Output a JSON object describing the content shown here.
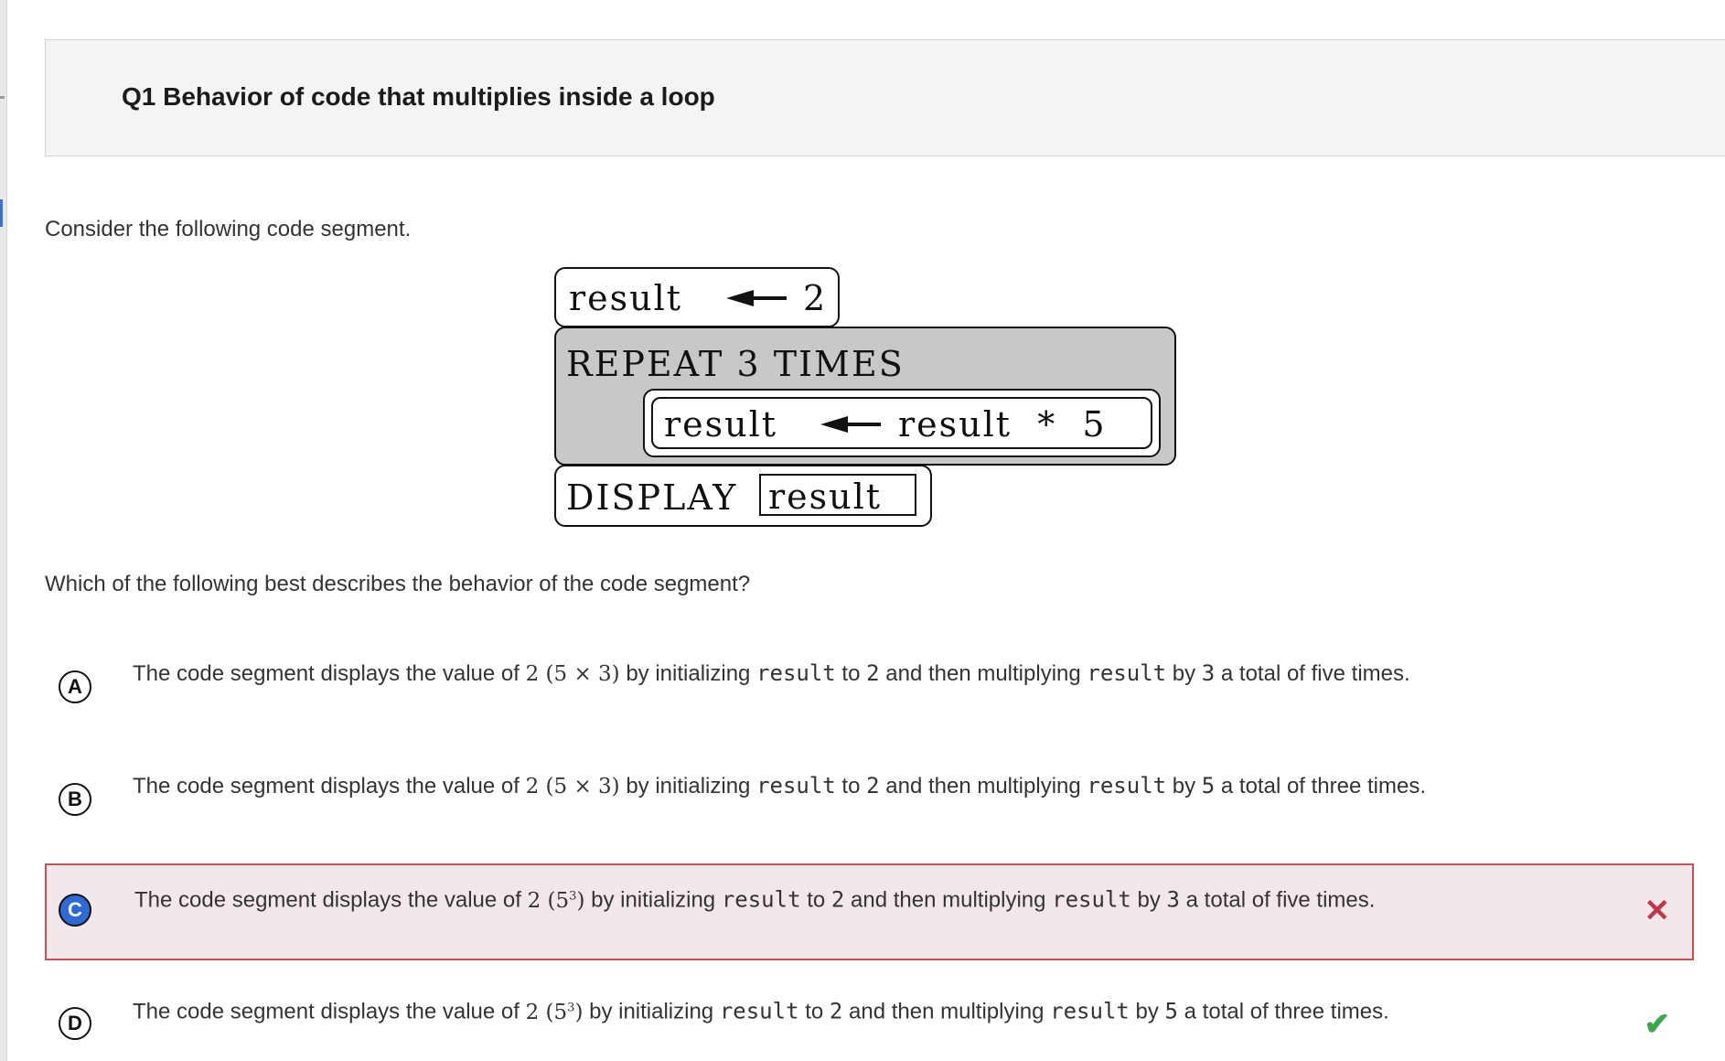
{
  "question": {
    "title": "Q1 Behavior of code that multiplies inside a loop",
    "intro": "Consider the following code segment.",
    "ask": "Which of the following best describes the behavior of the code segment?"
  },
  "code_block": {
    "line1_var": "result",
    "line1_val": "2",
    "repeat_label": "REPEAT 3 TIMES",
    "inner_lhs": "result",
    "inner_rhs": "result  *  5",
    "display_label": "DISPLAY",
    "display_arg": "result"
  },
  "options": [
    {
      "letter": "A",
      "prefix": "The code segment displays the value of ",
      "math": "2 (5 × 3)",
      "mid1": " by initializing ",
      "code1": "result",
      "mid2": " to ",
      "code2": "2",
      "mid3": " and then multiplying ",
      "code3": "result",
      "mid4": " by ",
      "code4": "3",
      "suffix": " a total of five times.",
      "selected": false,
      "status": ""
    },
    {
      "letter": "B",
      "prefix": "The code segment displays the value of ",
      "math": "2 (5 × 3)",
      "mid1": " by initializing ",
      "code1": "result",
      "mid2": " to ",
      "code2": "2",
      "mid3": " and then multiplying ",
      "code3": "result",
      "mid4": " by ",
      "code4": "5",
      "suffix": " a total of three times.",
      "selected": false,
      "status": ""
    },
    {
      "letter": "C",
      "prefix": "The code segment displays the value of ",
      "math_base": "2 (5",
      "math_exp": "3",
      "math_close": ")",
      "mid1": " by initializing ",
      "code1": "result",
      "mid2": " to ",
      "code2": "2",
      "mid3": " and then multiplying ",
      "code3": "result",
      "mid4": " by ",
      "code4": "3",
      "suffix": " a total of five times.",
      "selected": true,
      "status": "✕"
    },
    {
      "letter": "D",
      "prefix": "The code segment displays the value of ",
      "math_base": "2 (5",
      "math_exp": "3",
      "math_close": ")",
      "mid1": " by initializing ",
      "code1": "result",
      "mid2": " to ",
      "code2": "2",
      "mid3": " and then multiplying ",
      "code3": "result",
      "mid4": " by ",
      "code4": "5",
      "suffix": " a total of three times.",
      "selected": false,
      "status": "✔"
    }
  ],
  "colors": {
    "selected_bg": "#f3e8e9",
    "selected_border": "#d24b57",
    "wrong": "#c43447",
    "correct": "#3aa74c",
    "filled_letter": "#2d6ad6",
    "loop_bg": "#c8c8c8"
  },
  "icons": {
    "wrong": "x-mark-icon",
    "correct": "checkmark-icon",
    "assign": "left-arrow-icon"
  }
}
